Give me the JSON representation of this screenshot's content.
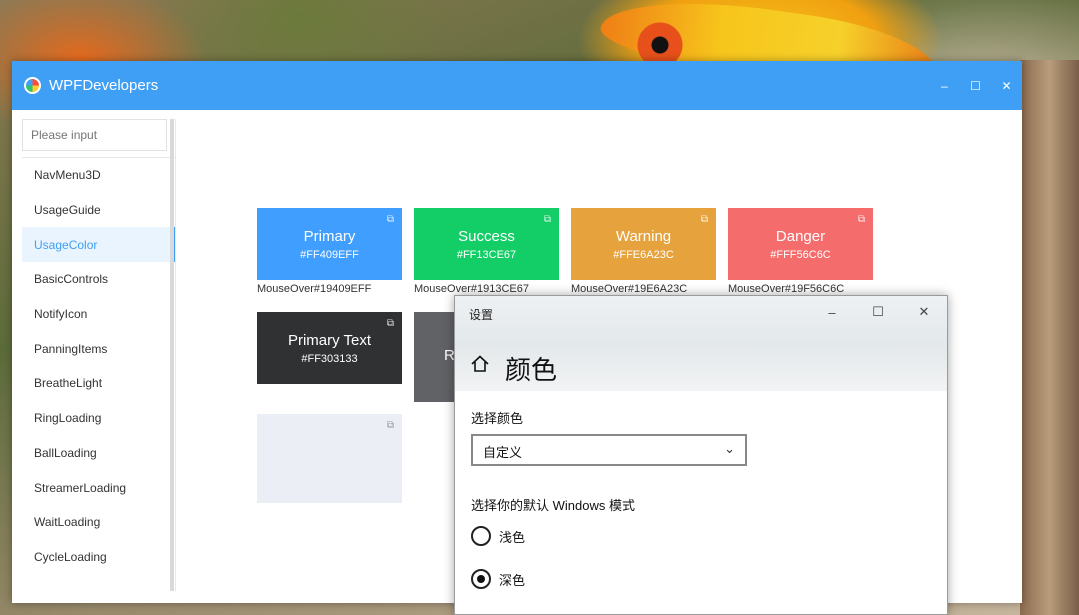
{
  "app": {
    "title": "WPFDevelopers"
  },
  "window_controls": {
    "minimize": "–",
    "maximize": "☐",
    "close": "✕"
  },
  "search": {
    "placeholder": "Please input"
  },
  "sidebar": {
    "items": [
      {
        "label": "NavMenu3D"
      },
      {
        "label": "UsageGuide"
      },
      {
        "label": "UsageColor"
      },
      {
        "label": "BasicControls"
      },
      {
        "label": "NotifyIcon"
      },
      {
        "label": "PanningItems"
      },
      {
        "label": "BreatheLight"
      },
      {
        "label": "RingLoading"
      },
      {
        "label": "BallLoading"
      },
      {
        "label": "StreamerLoading"
      },
      {
        "label": "WaitLoading"
      },
      {
        "label": "CycleLoading"
      }
    ],
    "active_index": 2
  },
  "colors": {
    "accent": "#3F9FF5",
    "primary": "#409EFF",
    "success": "#13CE67",
    "warning": "#E6A23C",
    "danger": "#F56C6C",
    "primary_text": "#303133"
  },
  "cards": [
    {
      "name": "Primary",
      "hex": "#FF409EFF",
      "mouseover": "MouseOver#19409EFF"
    },
    {
      "name": "Success",
      "hex": "#FF13CE67",
      "mouseover": "MouseOver#1913CE67"
    },
    {
      "name": "Warning",
      "hex": "#FFE6A23C",
      "mouseover": "MouseOver#19E6A23C"
    },
    {
      "name": "Danger",
      "hex": "#FFF56C6C",
      "mouseover": "MouseOver#19F56C6C"
    },
    {
      "name": "Primary Text",
      "hex": "#FF303133"
    },
    {
      "name": "R"
    }
  ],
  "settings_dialog": {
    "title": "设置",
    "heading": "颜色",
    "choose_color_label": "选择颜色",
    "choose_color_value": "自定义",
    "mode_label": "选择你的默认 Windows 模式",
    "options": [
      {
        "label": "浅色",
        "selected": false
      },
      {
        "label": "深色",
        "selected": true
      }
    ]
  }
}
